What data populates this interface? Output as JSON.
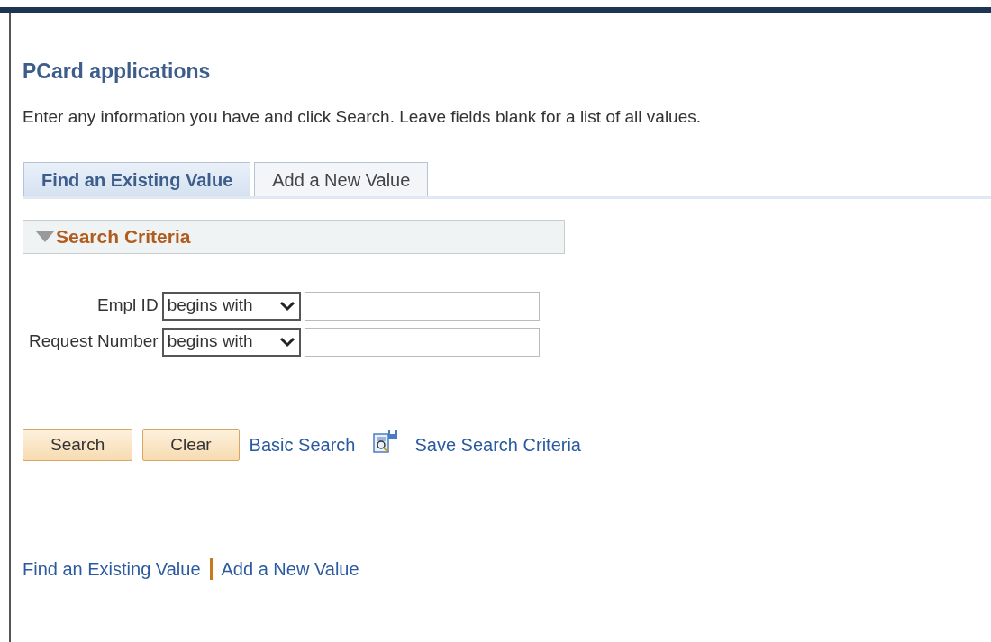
{
  "page": {
    "title": "PCard applications",
    "instructions": "Enter any information you have and click Search. Leave fields blank for a list of all values."
  },
  "tabs": [
    {
      "label": "Find an Existing Value",
      "selected": true
    },
    {
      "label": "Add a New Value",
      "selected": false
    }
  ],
  "section": {
    "title": "Search Criteria",
    "expanded": true
  },
  "fields": [
    {
      "label": "Empl ID",
      "operator": "begins with"
    },
    {
      "label": "Request Number",
      "operator": "begins with"
    }
  ],
  "buttons": [
    "Search",
    "Clear"
  ],
  "links": [
    {
      "label": "Basic Search",
      "kind": "link"
    },
    {
      "label": "Save Search Criteria",
      "kind": "icon-link"
    }
  ],
  "footer_links": [
    "Find an Existing Value",
    "Add a New Value"
  ]
}
